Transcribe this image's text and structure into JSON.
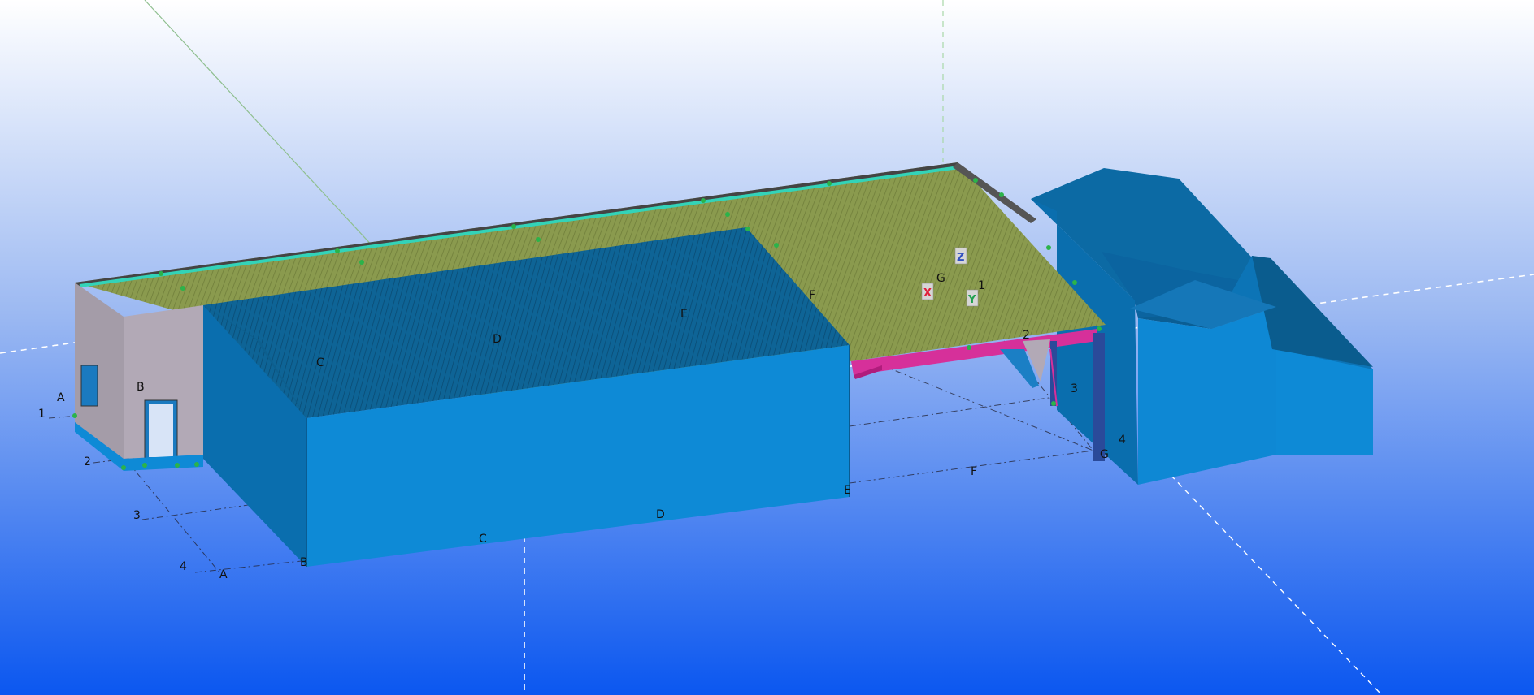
{
  "viewport": {
    "background_top": "#ffffff",
    "background_mid": "#8fb0f0",
    "background_bottom": "#0b57f0"
  },
  "colors": {
    "wall_blue": "#0e8ad6",
    "wall_blue_dark": "#0872b8",
    "roof_blue": "#0d5f8e",
    "roof_olive": "#8c9a4f",
    "gable_gray": "#b2a9b6",
    "beam_magenta": "#d6309a",
    "column_navy": "#2a4a9a",
    "ridge_teal": "#33d3b8"
  },
  "grid_labels": {
    "left_letters": [
      "A",
      "B"
    ],
    "left_numbers": [
      "1",
      "2",
      "3",
      "4"
    ],
    "bottom_front": [
      "A",
      "B",
      "C",
      "D",
      "E",
      "F",
      "G"
    ],
    "roof_letters": [
      "C",
      "D",
      "E",
      "F",
      "G"
    ],
    "right_numbers": [
      "1",
      "2",
      "3",
      "4"
    ]
  },
  "axis_gizmo": {
    "x": "X",
    "y": "Y",
    "z": "Z"
  }
}
